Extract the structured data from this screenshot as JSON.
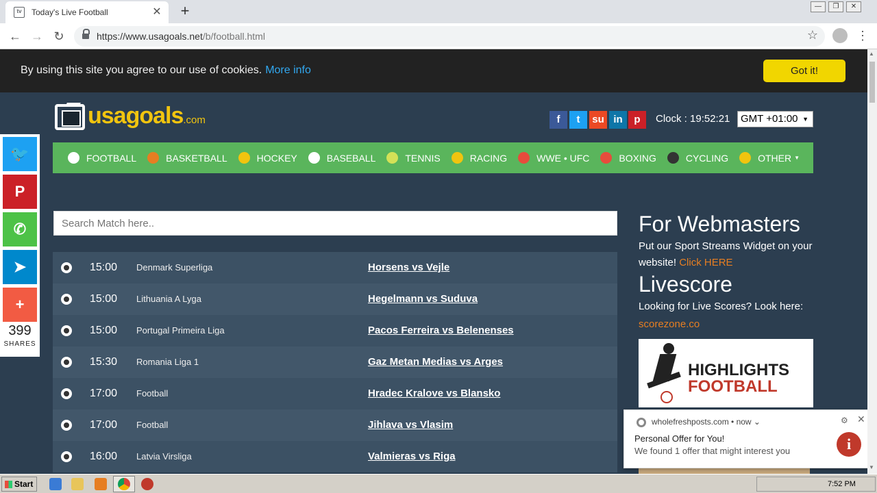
{
  "browser": {
    "tab_title": "Today's Live Football",
    "tab_favicon": "tv",
    "url_domain": "https://www.usagoals.net",
    "url_path": "/b/football.html",
    "win_min": "—",
    "win_max": "❐",
    "win_close": "✕"
  },
  "cookie": {
    "text": "By using this site you agree to our use of cookies.",
    "link": "More info",
    "button": "Got it!"
  },
  "logo": {
    "name": "usagoals",
    "tld": ".com"
  },
  "social": [
    {
      "icon": "facebook-icon",
      "glyph": "f",
      "color": "#3b5998"
    },
    {
      "icon": "twitter-icon",
      "glyph": "t",
      "color": "#1da1f2"
    },
    {
      "icon": "stumbleupon-icon",
      "glyph": "su",
      "color": "#eb4924"
    },
    {
      "icon": "linkedin-icon",
      "glyph": "in",
      "color": "#0e76a8"
    },
    {
      "icon": "pinterest-icon",
      "glyph": "p",
      "color": "#cb2027"
    }
  ],
  "clock": {
    "label": "Clock : 19:52:21",
    "timezone": "GMT +01:00"
  },
  "nav": [
    {
      "label": "FOOTBALL",
      "icon_color": "#ffffff"
    },
    {
      "label": "BASKETBALL",
      "icon_color": "#e67e22"
    },
    {
      "label": "HOCKEY",
      "icon_color": "#f1c40f"
    },
    {
      "label": "BASEBALL",
      "icon_color": "#ffffff"
    },
    {
      "label": "TENNIS",
      "icon_color": "#d4e157"
    },
    {
      "label": "RACING",
      "icon_color": "#f1c40f"
    },
    {
      "label": "WWE • UFC",
      "icon_color": "#e74c3c"
    },
    {
      "label": "BOXING",
      "icon_color": "#e74c3c"
    },
    {
      "label": "CYCLING",
      "icon_color": "#333333"
    },
    {
      "label": "OTHER",
      "icon_color": "#f1c40f"
    }
  ],
  "search": {
    "placeholder": "Search Match here.."
  },
  "matches": [
    {
      "time": "15:00",
      "league": "Denmark Superliga",
      "teams": "Horsens vs Vejle"
    },
    {
      "time": "15:00",
      "league": "Lithuania A Lyga",
      "teams": "Hegelmann vs Suduva"
    },
    {
      "time": "15:00",
      "league": "Portugal Primeira Liga",
      "teams": "Pacos Ferreira vs Belenenses"
    },
    {
      "time": "15:30",
      "league": "Romania Liga 1",
      "teams": "Gaz Metan Medias vs Arges"
    },
    {
      "time": "17:00",
      "league": "Football",
      "teams": "Hradec Kralove vs Blansko"
    },
    {
      "time": "17:00",
      "league": "Football",
      "teams": "Jihlava vs Vlasim"
    },
    {
      "time": "16:00",
      "league": "Latvia Virsliga",
      "teams": "Valmieras vs Riga"
    }
  ],
  "sidebar": {
    "webmasters_title": "For Webmasters",
    "webmasters_text": "Put our Sport Streams Widget on your website!",
    "webmasters_link": "Click HERE",
    "livescore_title": "Livescore",
    "livescore_text": "Looking for Live Scores? Look here:",
    "livescore_link": "scorezone.co",
    "banner_line1": "HIGHLIGHTS",
    "banner_line2": "FOOTBALL"
  },
  "share": {
    "buttons": [
      {
        "icon": "twitter-icon",
        "glyph": "🐦",
        "color": "#1da1f2"
      },
      {
        "icon": "pinterest-icon",
        "glyph": "P",
        "color": "#cb2027"
      },
      {
        "icon": "whatsapp-icon",
        "glyph": "✆",
        "color": "#4dc247"
      },
      {
        "icon": "telegram-icon",
        "glyph": "➤",
        "color": "#0088cc"
      },
      {
        "icon": "plus-icon",
        "glyph": "+",
        "color": "#f25b43"
      }
    ],
    "count": "399",
    "label": "SHARES"
  },
  "notification": {
    "source": "wholefreshposts.com • now ⌄",
    "title": "Personal Offer for You!",
    "body": "We found 1 offer that might interest you",
    "icon_glyph": "i"
  },
  "taskbar": {
    "start": "Start",
    "time": "7:52 PM"
  }
}
